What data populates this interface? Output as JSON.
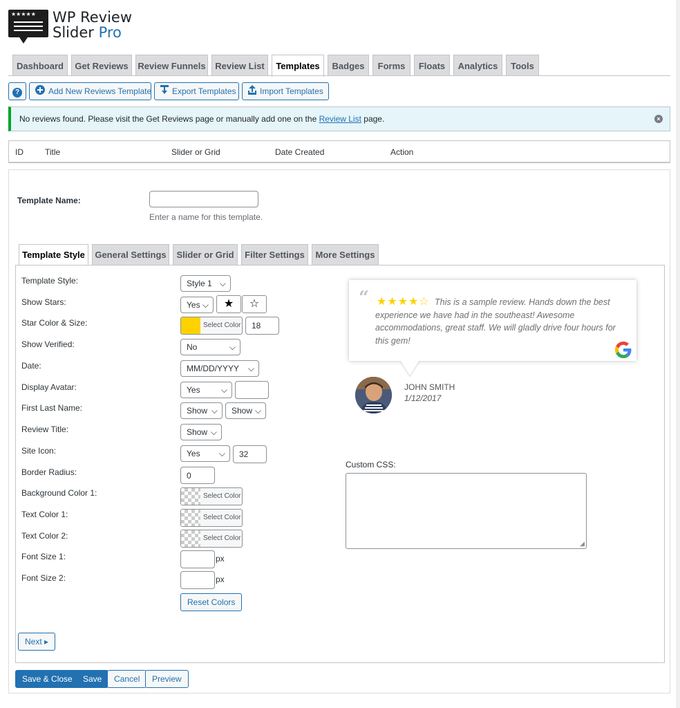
{
  "brand": {
    "line1": "WP Review",
    "line2": "Slider",
    "pro": "Pro",
    "logo_stars": "★★★★★"
  },
  "nav_tabs": [
    "Dashboard",
    "Get Reviews",
    "Review Funnels",
    "Review List",
    "Templates",
    "Badges",
    "Forms",
    "Floats",
    "Analytics",
    "Tools"
  ],
  "active_nav_tab": "Templates",
  "actions": {
    "help": "?",
    "add_new": "Add New Reviews Template",
    "export": "Export Templates",
    "import": "Import Templates"
  },
  "notice": {
    "before": "No reviews found. Please visit the Get Reviews page or manually add one on the ",
    "link": "Review List",
    "after": " page.",
    "close": "×"
  },
  "table": {
    "headers": [
      "ID",
      "Title",
      "Slider or Grid",
      "Date Created",
      "Action"
    ]
  },
  "template_name": {
    "label": "Template Name:",
    "value": "",
    "hint": "Enter a name for this template."
  },
  "sub_tabs": [
    "Template Style",
    "General Settings",
    "Slider or Grid",
    "Filter Settings",
    "More Settings"
  ],
  "active_sub_tab": "Template Style",
  "fields": {
    "template_style": {
      "label": "Template Style:",
      "value": "Style 1"
    },
    "show_stars": {
      "label": "Show Stars:",
      "value": "Yes",
      "filled_star": "★",
      "empty_star": "☆"
    },
    "star_color_size": {
      "label": "Star Color & Size:",
      "color_button": "Select Color",
      "color": "#fdd200",
      "size": "18"
    },
    "show_verified": {
      "label": "Show Verified:",
      "value": "No"
    },
    "date": {
      "label": "Date:",
      "value": "MM/DD/YYYY"
    },
    "display_avatar": {
      "label": "Display Avatar:",
      "value": "Yes",
      "size": ""
    },
    "first_last_name": {
      "label": "First Last Name:",
      "first": "Show",
      "last": "Show"
    },
    "review_title": {
      "label": "Review Title:",
      "value": "Show"
    },
    "site_icon": {
      "label": "Site Icon:",
      "value": "Yes",
      "size": "32"
    },
    "border_radius": {
      "label": "Border Radius:",
      "value": "0"
    },
    "bg_color_1": {
      "label": "Background Color 1:",
      "color_button": "Select Color"
    },
    "text_color_1": {
      "label": "Text Color 1:",
      "color_button": "Select Color"
    },
    "text_color_2": {
      "label": "Text Color 2:",
      "color_button": "Select Color"
    },
    "font_size_1": {
      "label": "Font Size 1:",
      "value": "",
      "unit": "px"
    },
    "font_size_2": {
      "label": "Font Size 2:",
      "value": "",
      "unit": "px"
    },
    "reset_colors": "Reset Colors"
  },
  "preview": {
    "quote_mark": "“",
    "stars": "★★★★☆",
    "text": "This is a sample review. Hands down the best experience we have had in the southeast! Awesome accommodations, great staff. We will gladly drive four hours for this gem!",
    "reviewer": "JOHN SMITH",
    "date": "1/12/2017",
    "site_icon": "google-icon"
  },
  "custom_css": {
    "label": "Custom CSS:",
    "value": ""
  },
  "next_button": "Next ▸",
  "footer_buttons": {
    "save_close": "Save & Close",
    "save": "Save",
    "cancel": "Cancel",
    "preview": "Preview"
  },
  "colors": {
    "accent": "#2271b1",
    "notice_border": "#00a32a",
    "notice_bg": "#e5f5fa",
    "star": "#fdd200"
  }
}
